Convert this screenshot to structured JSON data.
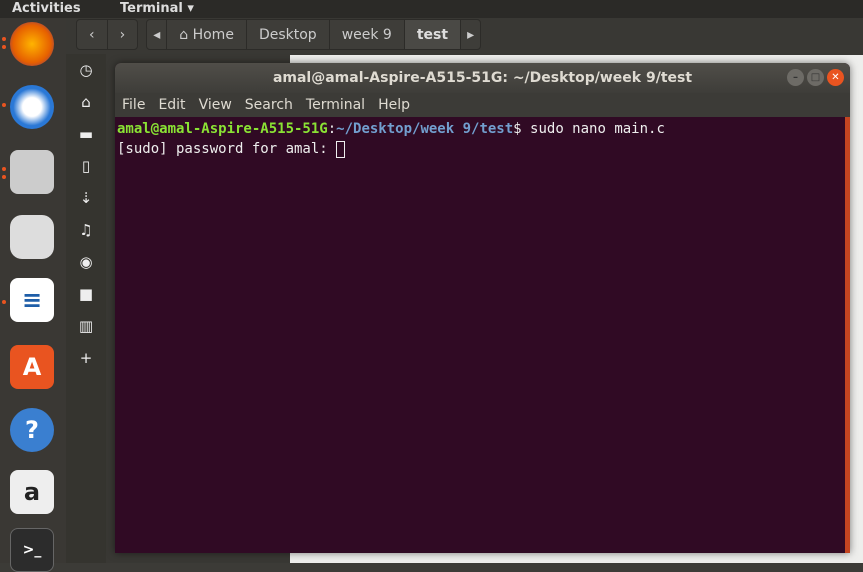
{
  "topbar": {
    "activities": "Activities",
    "app": "Terminal ▾"
  },
  "dock": [
    "firefox",
    "thunderbird",
    "files",
    "rhythmbox",
    "libreoffice-writer",
    "software-center",
    "help",
    "amazon",
    "terminal"
  ],
  "files": {
    "nav_back": "‹",
    "nav_forward": "›",
    "path_left": "◂",
    "path_right": "▸",
    "path": [
      "Home",
      "Desktop",
      "week 9",
      "test"
    ],
    "sidebar": [
      "◷",
      "⌂",
      "▬",
      "▯",
      "⇣",
      "♫",
      "◉",
      "■",
      "▥",
      "+"
    ]
  },
  "terminal": {
    "title": "amal@amal-Aspire-A515-51G: ~/Desktop/week 9/test",
    "menu": [
      "File",
      "Edit",
      "View",
      "Search",
      "Terminal",
      "Help"
    ],
    "prompt_user": "amal@amal-Aspire-A515-51G",
    "prompt_sep": ":",
    "prompt_path": "~/Desktop/week 9/test",
    "prompt_end": "$ ",
    "command": "sudo nano main.c",
    "line2": "[sudo] password for amal: "
  },
  "colors": {
    "terminal_bg": "#300a24",
    "accent": "#e95420"
  }
}
